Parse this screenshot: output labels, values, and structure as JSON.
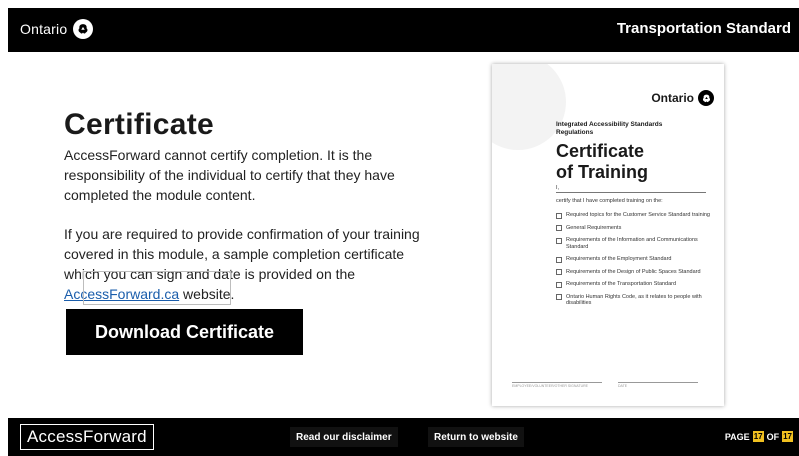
{
  "header": {
    "brand": "Ontario",
    "title": "Transportation Standard"
  },
  "main": {
    "heading": "Certificate",
    "paragraph1": "AccessForward cannot certify completion. It is the responsibility of the individual to certify that they have completed the module content.",
    "paragraph2_before": "If you are required to provide confirmation of your training covered in this module, a sample completion certificate which you can sign and date is provided on the ",
    "paragraph2_link": "AccessForward.ca",
    "paragraph2_after": " website.",
    "download_button": "Download Certificate"
  },
  "certificate": {
    "brand": "Ontario",
    "subtitle": "Integrated Accessibility Standards Regulations",
    "title_line1": "Certificate",
    "title_line2": "of Training",
    "i_label": "I,",
    "certify_text": "certify that I have completed training on the:",
    "items": [
      "Required topics for the Customer Service Standard training",
      "General Requirements",
      "Requirements of the Information and Communications Standard",
      "Requirements of the Employment Standard",
      "Requirements of the Design of Public Spaces Standard",
      "Requirements of the Transportation Standard",
      "Ontario Human Rights Code, as it relates to people with disabilities"
    ],
    "signature_label": "EMPLOYEE/VOLUNTEER/OTHER SIGNATURE",
    "date_label": "DATE"
  },
  "footer": {
    "logo": "AccessForward",
    "disclaimer_button": "Read our disclaimer",
    "return_button": "Return to website",
    "page_prefix": "PAGE",
    "page_current": "17",
    "page_of": "OF",
    "page_total": "17"
  },
  "colors": {
    "bar": "#000000",
    "link": "#1a5dab",
    "page_badge": "#f0c020"
  }
}
